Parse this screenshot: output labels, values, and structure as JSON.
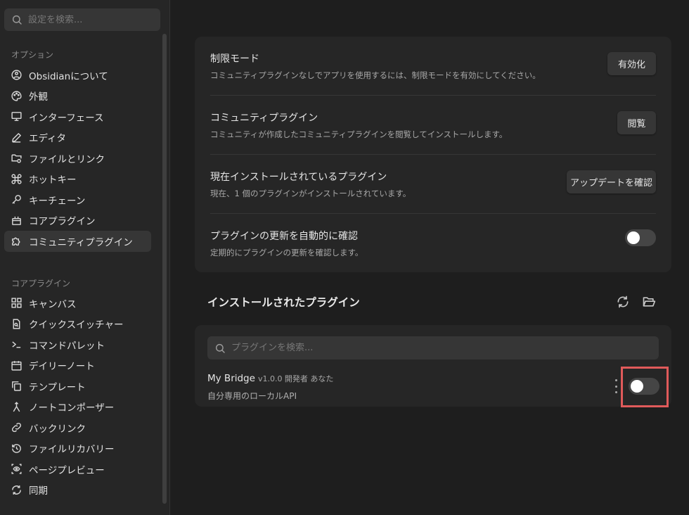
{
  "sidebar": {
    "search_placeholder": "設定を検索...",
    "options_header": "オプション",
    "options": [
      {
        "label": "Obsidianについて",
        "icon": "info-icon"
      },
      {
        "label": "外観",
        "icon": "palette-icon"
      },
      {
        "label": "インターフェース",
        "icon": "monitor-icon"
      },
      {
        "label": "エディタ",
        "icon": "pen-icon"
      },
      {
        "label": "ファイルとリンク",
        "icon": "folder-link-icon"
      },
      {
        "label": "ホットキー",
        "icon": "command-icon"
      },
      {
        "label": "キーチェーン",
        "icon": "key-icon"
      },
      {
        "label": "コアプラグイン",
        "icon": "plug-icon"
      },
      {
        "label": "コミュニティプラグイン",
        "icon": "puzzle-icon",
        "active": true
      }
    ],
    "core_header": "コアプラグイン",
    "core": [
      {
        "label": "キャンバス",
        "icon": "canvas-icon"
      },
      {
        "label": "クイックスイッチャー",
        "icon": "file-search-icon"
      },
      {
        "label": "コマンドパレット",
        "icon": "terminal-icon"
      },
      {
        "label": "デイリーノート",
        "icon": "calendar-icon"
      },
      {
        "label": "テンプレート",
        "icon": "copy-icon"
      },
      {
        "label": "ノートコンポーザー",
        "icon": "merge-icon"
      },
      {
        "label": "バックリンク",
        "icon": "link-icon"
      },
      {
        "label": "ファイルリカバリー",
        "icon": "history-icon"
      },
      {
        "label": "ページプレビュー",
        "icon": "eye-icon"
      },
      {
        "label": "同期",
        "icon": "sync-icon"
      }
    ]
  },
  "settings": {
    "restricted": {
      "name": "制限モード",
      "desc": "コミュニティプラグインなしでアプリを使用するには、制限モードを有効にしてください。",
      "button": "有効化"
    },
    "community": {
      "name": "コミュニティプラグイン",
      "desc": "コミュニティが作成したコミュニティプラグインを閲覧してインストールします。",
      "button": "閲覧"
    },
    "installed": {
      "name": "現在インストールされているプラグイン",
      "desc": "現在、1 個のプラグインがインストールされています。",
      "button": "アップデートを確認"
    },
    "autoupdate": {
      "name": "プラグインの更新を自動的に確認",
      "desc": "定期的にプラグインの更新を確認します。",
      "enabled": false
    }
  },
  "installed_section": {
    "title": "インストールされたプラグイン",
    "search_placeholder": "プラグインを検索...",
    "plugins": [
      {
        "name": "My Bridge",
        "meta": "v1.0.0 開発者 あなた",
        "desc": "自分専用のローカルAPI",
        "enabled": false
      }
    ]
  },
  "colors": {
    "highlight": "#e05a5a",
    "background": "#1e1e1e",
    "card": "#262626"
  }
}
